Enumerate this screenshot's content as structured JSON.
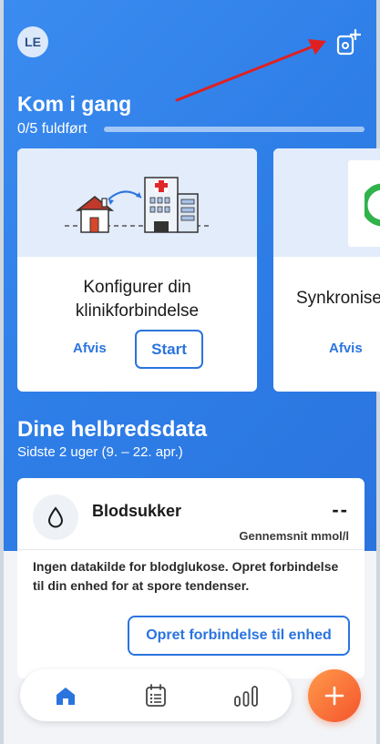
{
  "header": {
    "avatar_initials": "LE",
    "add_device_icon": "add-device-icon"
  },
  "get_started": {
    "title": "Kom i gang",
    "progress_text": "0/5 fuldført",
    "progress_value": 0,
    "cards": [
      {
        "title_line1": "Konfigurer din",
        "title_line2": "klinikforbindelse",
        "dismiss_label": "Afvis",
        "start_label": "Start",
        "illustration": "house-to-clinic-illustration"
      },
      {
        "title_line1": "Synkronise",
        "dismiss_label": "Afvis",
        "illustration": "sync-illustration"
      }
    ]
  },
  "health_data": {
    "title": "Dine helbredsdata",
    "subtitle": "Sidste 2 uger (9. – 22. apr.)",
    "metric": {
      "name": "Blodsukker",
      "value": "--",
      "unit_label": "Gennemsnit mmol/l",
      "icon": "drop-icon",
      "message": "Ingen datakilde for blodglukose. Opret forbindelse til din enhed for at spore tendenser.",
      "connect_label": "Opret forbindelse til enhed"
    }
  },
  "nav": {
    "items": [
      "home-icon",
      "calendar-list-icon",
      "bar-chart-icon"
    ],
    "fab_icon": "plus-icon"
  },
  "colors": {
    "accent": "#2a74de",
    "annotation_arrow": "#e02020",
    "fab_start": "#ff9a4a",
    "fab_end": "#f4542d"
  }
}
